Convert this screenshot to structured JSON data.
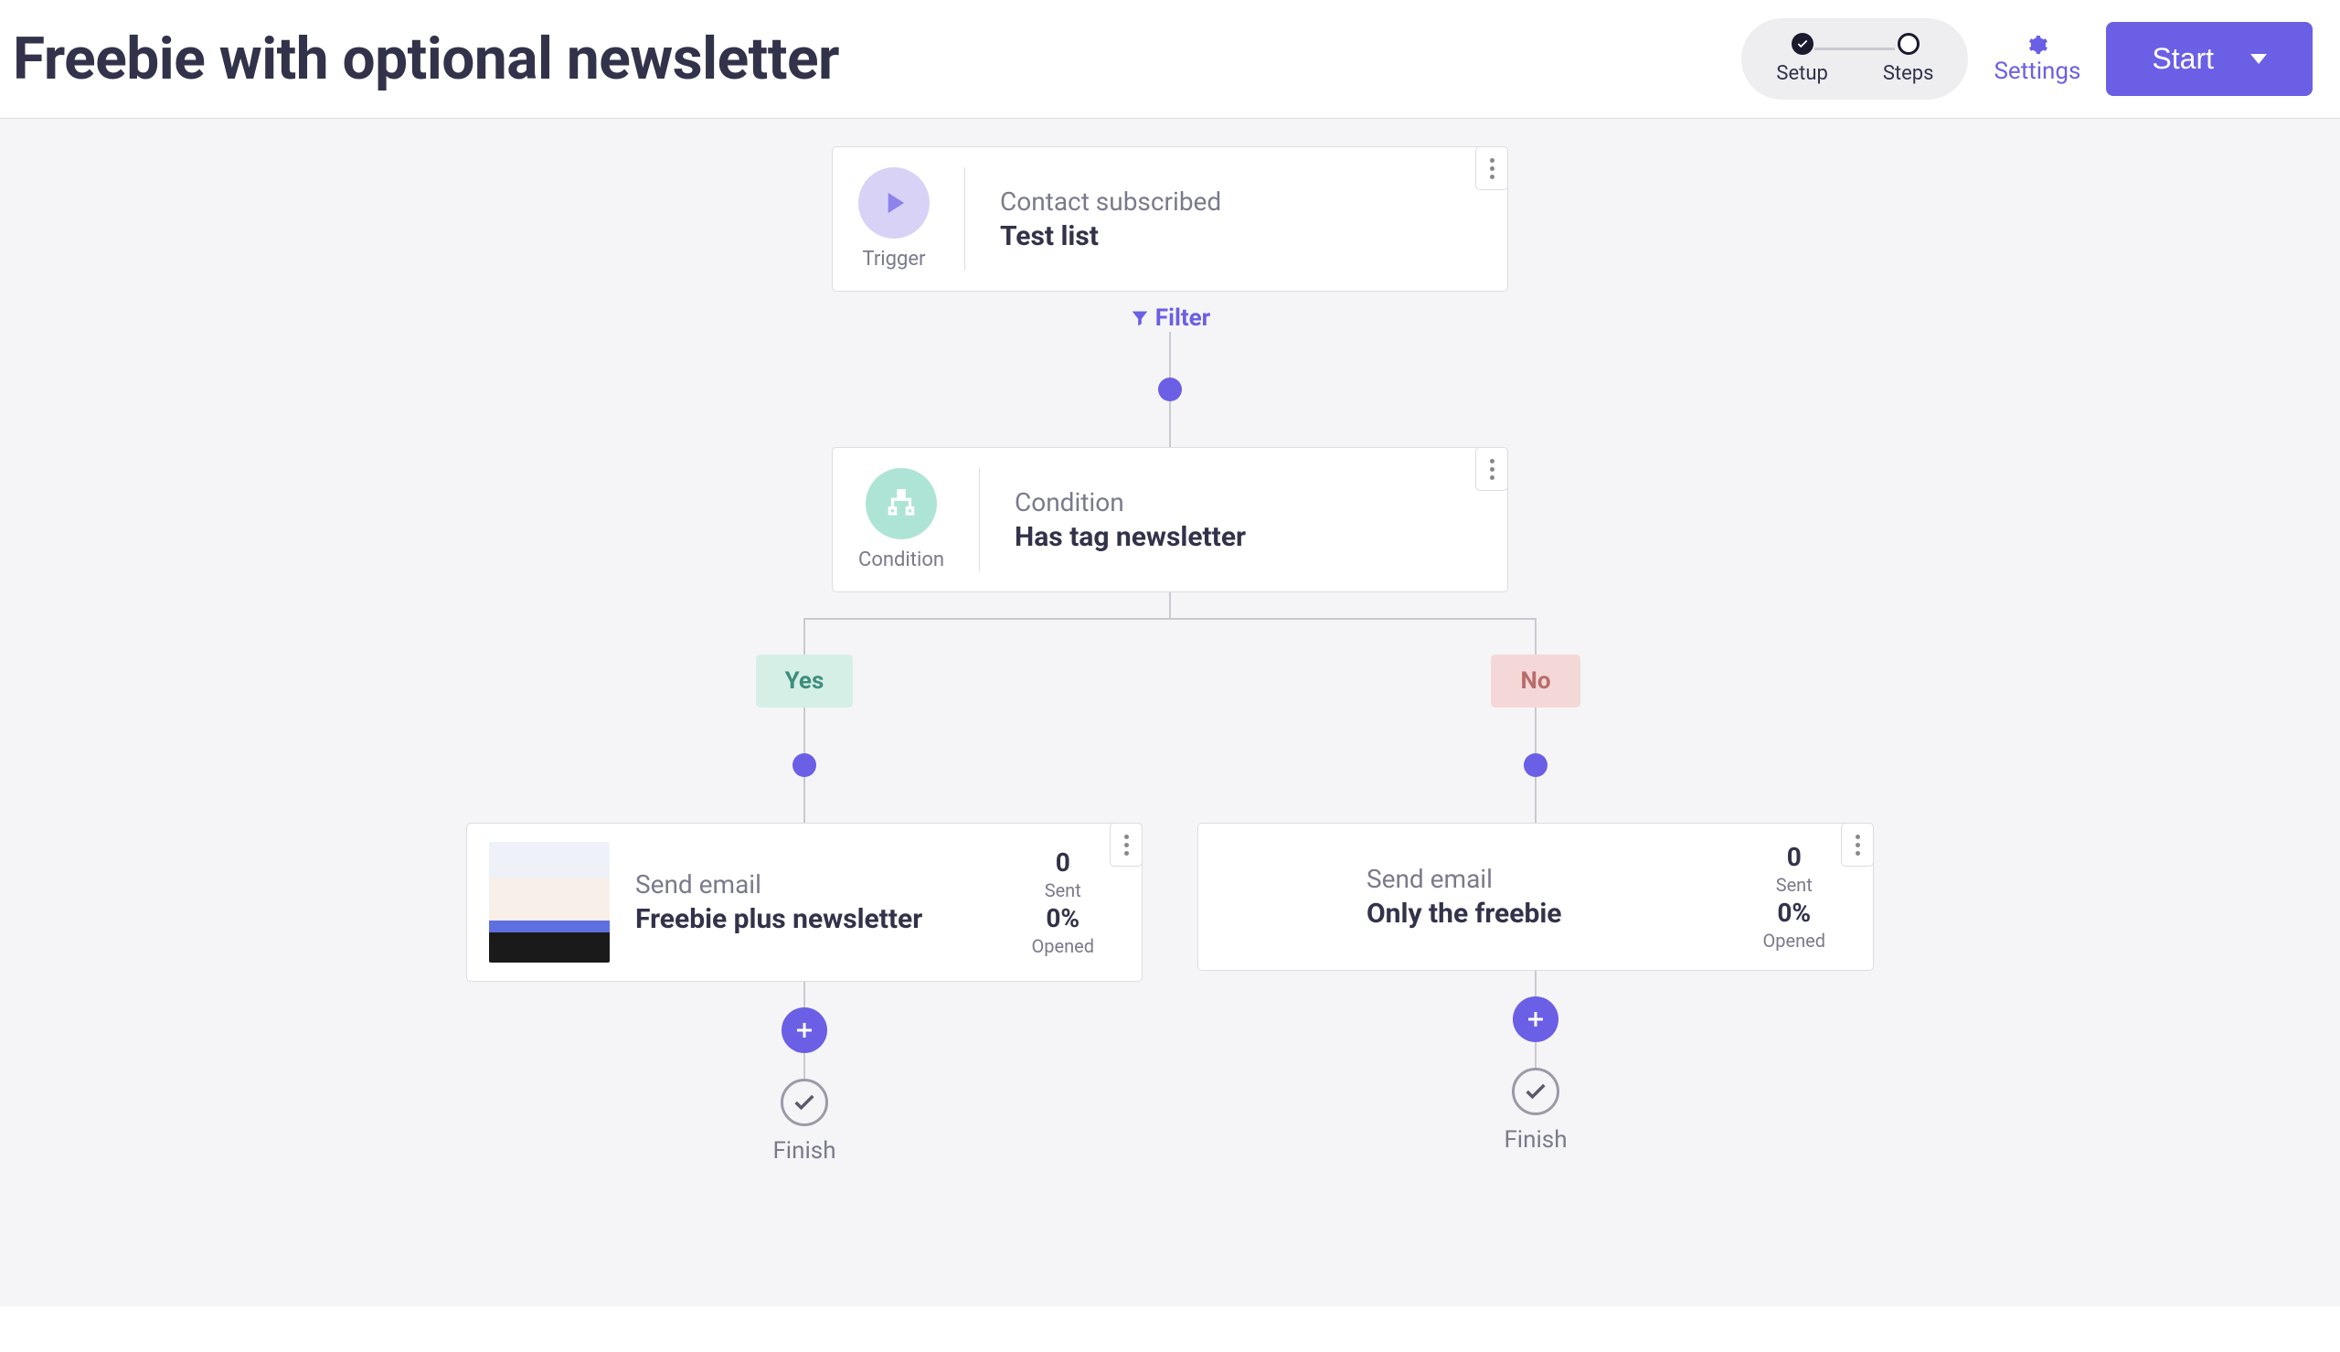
{
  "header": {
    "title": "Freebie with optional newsletter",
    "steps": {
      "setup": "Setup",
      "steps": "Steps"
    },
    "settings_label": "Settings",
    "start_label": "Start"
  },
  "trigger": {
    "type_label": "Trigger",
    "subtitle": "Contact subscribed",
    "title": "Test list"
  },
  "filter_label": "Filter",
  "condition": {
    "type_label": "Condition",
    "subtitle": "Condition",
    "title": "Has tag newsletter"
  },
  "branches": {
    "yes": {
      "tag": "Yes",
      "email": {
        "subtitle": "Send email",
        "title": "Freebie plus newsletter",
        "sent_value": "0",
        "sent_label": "Sent",
        "opened_value": "0%",
        "opened_label": "Opened"
      },
      "finish": "Finish"
    },
    "no": {
      "tag": "No",
      "email": {
        "subtitle": "Send email",
        "title": "Only the freebie",
        "sent_value": "0",
        "sent_label": "Sent",
        "opened_value": "0%",
        "opened_label": "Opened"
      },
      "finish": "Finish"
    }
  }
}
